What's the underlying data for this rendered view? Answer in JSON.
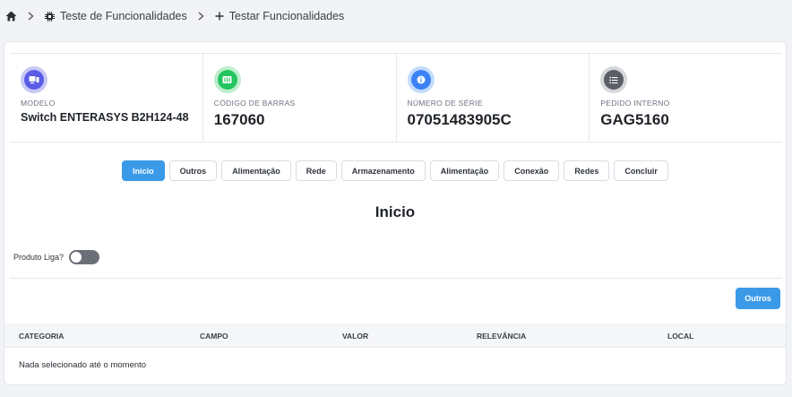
{
  "breadcrumb": {
    "home_icon": "home-icon",
    "item1": "Teste de Funcionalidades",
    "item1_icon": "chip-icon",
    "item2": "Testar Funcionalidades",
    "item2_icon": "plus-icon"
  },
  "info": [
    {
      "label": "MODELO",
      "value": "Switch ENTERASYS B2H124-48",
      "icon": "device-icon",
      "color": "#5b5ce6"
    },
    {
      "label": "CÓDIGO DE BARRAS",
      "value": "167060",
      "icon": "barcode-icon",
      "color": "#22c55e"
    },
    {
      "label": "NÚMERO DE SÉRIE",
      "value": "07051483905C",
      "icon": "info-icon",
      "color": "#3b82f6"
    },
    {
      "label": "PEDIDO INTERNO",
      "value": "GAG5160",
      "icon": "list-icon",
      "color": "#5a5f66"
    }
  ],
  "tabs": [
    "Inicio",
    "Outros",
    "Alimentação",
    "Rede",
    "Armazenamento",
    "Alimentação",
    "Conexão",
    "Redes",
    "Concluir"
  ],
  "active_tab": "Inicio",
  "section_title": "Inicio",
  "toggle": {
    "label": "Produto Liga?",
    "on": false
  },
  "outros_button": "Outros",
  "table": {
    "columns": [
      "CATEGORIA",
      "CAMPO",
      "VALOR",
      "RELEVÂNCIA",
      "LOCAL"
    ],
    "empty_message": "Nada selecionado até o momento"
  },
  "colors": {
    "accent": "#3b9ae8"
  }
}
